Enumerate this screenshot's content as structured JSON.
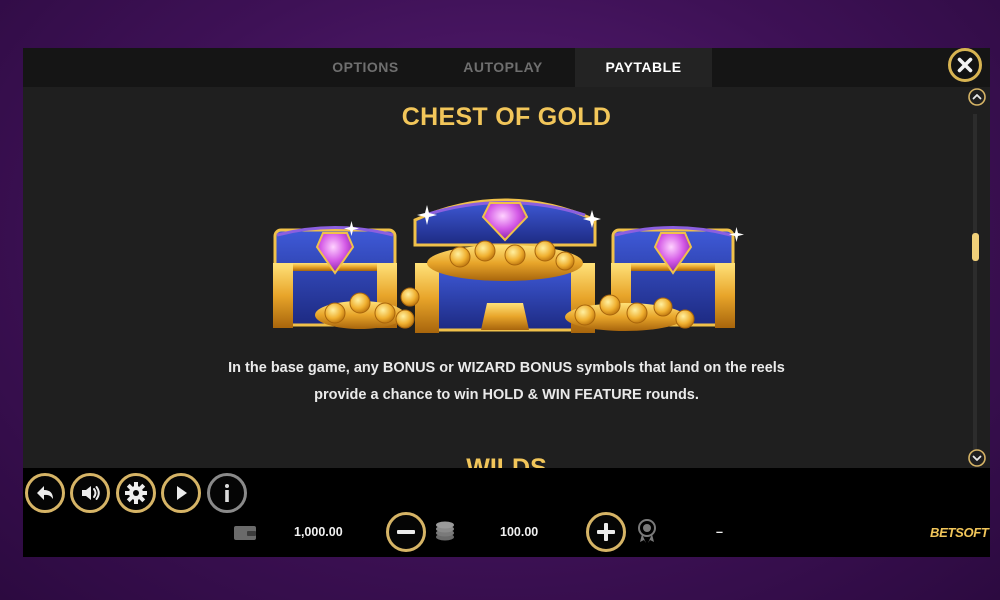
{
  "tabs": [
    {
      "label": "OPTIONS",
      "active": false
    },
    {
      "label": "AUTOPLAY",
      "active": false
    },
    {
      "label": "PAYTABLE",
      "active": true
    }
  ],
  "paytable": {
    "section_title": "CHEST OF GOLD",
    "description_line1": "In the base game, any BONUS or WIZARD BONUS symbols that land on the reels",
    "description_line2": "provide a chance to win HOLD & WIN FEATURE rounds.",
    "next_section_title": "WILDS"
  },
  "footer": {
    "balance": "1,000.00",
    "bet": "100.00",
    "win": "–",
    "logo_part1": "BET",
    "logo_part2": "SOFT"
  },
  "icons": {
    "close": "close-icon",
    "back": "back-arrow-icon",
    "sound": "speaker-icon",
    "settings": "gear-icon",
    "autoplay": "autoplay-icon",
    "info": "info-icon",
    "wallet": "wallet-icon",
    "coins": "coin-stack-icon",
    "win": "award-badge-icon",
    "scroll_up": "chevron-up-icon",
    "scroll_down": "chevron-down-icon"
  },
  "colors": {
    "accent_gold": "#f2c65a",
    "button_ring": "#d6b466",
    "panel_bg": "#1f1f1f",
    "tab_active_text": "#ffffff",
    "tab_inactive_text": "#6f6f6f"
  }
}
